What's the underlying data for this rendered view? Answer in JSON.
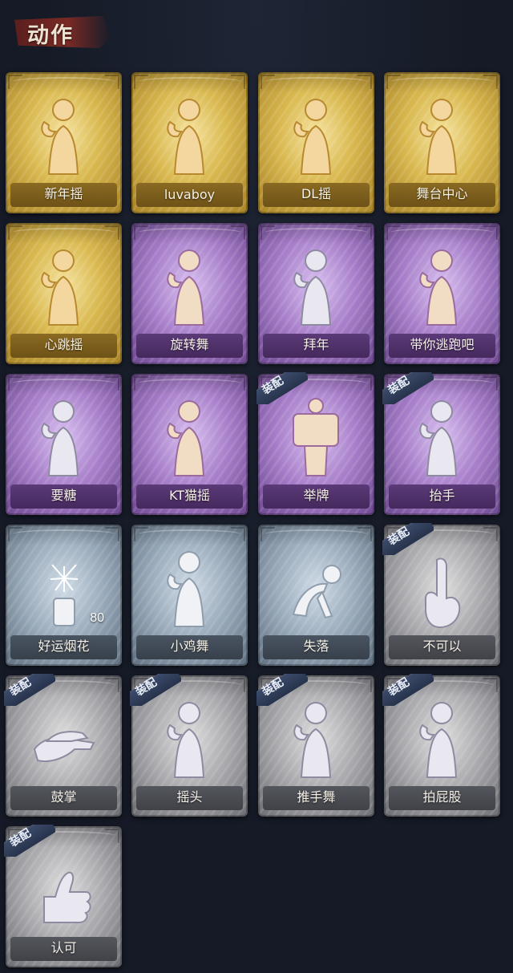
{
  "header": {
    "title": "动作"
  },
  "cards": [
    {
      "label": "新年摇",
      "tier": "gold",
      "equipped": false,
      "count": ""
    },
    {
      "label": "luvaboy",
      "tier": "gold",
      "equipped": false,
      "count": ""
    },
    {
      "label": "DL摇",
      "tier": "gold",
      "equipped": false,
      "count": ""
    },
    {
      "label": "舞台中心",
      "tier": "gold",
      "equipped": false,
      "count": ""
    },
    {
      "label": "心跳摇",
      "tier": "gold",
      "equipped": false,
      "count": ""
    },
    {
      "label": "旋转舞",
      "tier": "purple",
      "equipped": false,
      "count": ""
    },
    {
      "label": "拜年",
      "tier": "purple",
      "equipped": false,
      "count": ""
    },
    {
      "label": "带你逃跑吧",
      "tier": "purple",
      "equipped": false,
      "count": ""
    },
    {
      "label": "要糖",
      "tier": "purple",
      "equipped": false,
      "count": ""
    },
    {
      "label": "KT猫摇",
      "tier": "purple",
      "equipped": false,
      "count": ""
    },
    {
      "label": "举牌",
      "tier": "purple",
      "equipped": true,
      "count": ""
    },
    {
      "label": "抬手",
      "tier": "purple",
      "equipped": true,
      "count": ""
    },
    {
      "label": "好运烟花",
      "tier": "blue",
      "equipped": false,
      "count": "80"
    },
    {
      "label": "小鸡舞",
      "tier": "blue",
      "equipped": false,
      "count": ""
    },
    {
      "label": "失落",
      "tier": "blue",
      "equipped": false,
      "count": ""
    },
    {
      "label": "不可以",
      "tier": "gray",
      "equipped": true,
      "count": ""
    },
    {
      "label": "鼓掌",
      "tier": "gray",
      "equipped": true,
      "count": ""
    },
    {
      "label": "摇头",
      "tier": "gray",
      "equipped": true,
      "count": ""
    },
    {
      "label": "推手舞",
      "tier": "gray",
      "equipped": true,
      "count": ""
    },
    {
      "label": "拍屁股",
      "tier": "gray",
      "equipped": true,
      "count": ""
    },
    {
      "label": "认可",
      "tier": "gray",
      "equipped": true,
      "count": ""
    }
  ],
  "equip_badge_text": "装配",
  "colors": {
    "gold": "#d9b94f",
    "purple": "#a57cc8",
    "blue": "#98a9b9",
    "gray": "#a8a8ac",
    "background": "#151a26",
    "header_accent": "#7a2a25"
  },
  "icons": [
    "dancing-figure-icon",
    "shrug-figure-icon",
    "point-up-figure-icon",
    "sparkle-figure-icon",
    "heartbeat-figure-icon",
    "spin-dance-icon",
    "greeting-bow-icon",
    "run-away-icon",
    "candy-ask-icon",
    "cat-dance-icon",
    "sign-board-icon",
    "raise-hand-icon",
    "firework-icon",
    "chicken-dance-icon",
    "crawling-sad-icon",
    "wag-finger-icon",
    "clap-hands-icon",
    "shake-head-icon",
    "push-dance-icon",
    "slap-bottom-icon",
    "thumbs-up-icon"
  ]
}
